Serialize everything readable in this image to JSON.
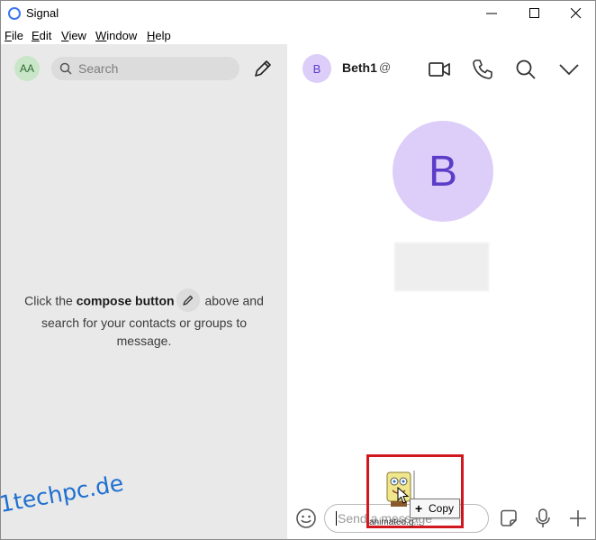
{
  "window": {
    "title": "Signal"
  },
  "menu": [
    {
      "underline": "F",
      "rest": "ile"
    },
    {
      "underline": "E",
      "rest": "dit"
    },
    {
      "underline": "V",
      "rest": "iew"
    },
    {
      "underline": "W",
      "rest": "indow"
    },
    {
      "underline": "H",
      "rest": "elp"
    }
  ],
  "sidebar": {
    "avatar_initials": "AA",
    "search_placeholder": "Search",
    "empty": {
      "before": "Click the ",
      "bold": "compose button",
      "after": " above and search for your contacts or groups to message."
    }
  },
  "conversation": {
    "avatar_initial": "B",
    "name": "Beth1",
    "at_symbol": "@",
    "big_avatar_initial": "B",
    "composer_placeholder": "Send a message"
  },
  "drag": {
    "file_label": "animated.g...",
    "tooltip_plus": "+",
    "tooltip_label": "Copy"
  },
  "watermark": "1techpc.de",
  "colors": {
    "accent": "#3a76f0",
    "avatar_bg": "#ddcef9",
    "avatar_fg": "#5a3ec8",
    "highlight_frame": "#d0181e"
  }
}
